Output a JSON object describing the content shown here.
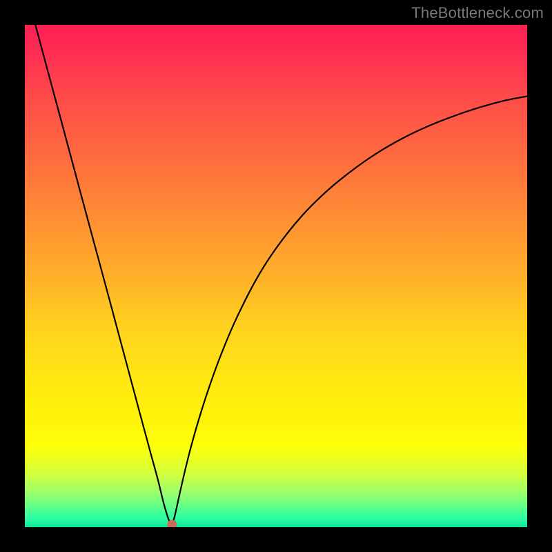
{
  "watermark": "TheBottleneck.com",
  "chart_data": {
    "type": "line",
    "title": "",
    "xlabel": "",
    "ylabel": "",
    "xlim": [
      0,
      1
    ],
    "ylim": [
      0,
      1
    ],
    "grid": false,
    "legend": false,
    "description": "Bottleneck-style curve from TheBottleneck.com: a single black line that drops steeply from the top-left, reaches a near-zero minimum around x≈0.29, then rises with decreasing slope toward the right edge (ending near y≈0.85). A small dot marks the minimum.",
    "series": [
      {
        "name": "curve",
        "color": "#000000",
        "x": [
          0.021,
          0.05,
          0.08,
          0.11,
          0.14,
          0.17,
          0.2,
          0.23,
          0.25,
          0.265,
          0.275,
          0.283,
          0.29,
          0.295,
          0.3,
          0.307,
          0.318,
          0.33,
          0.345,
          0.365,
          0.39,
          0.42,
          0.46,
          0.5,
          0.55,
          0.6,
          0.65,
          0.7,
          0.75,
          0.8,
          0.85,
          0.9,
          0.95,
          1.0
        ],
        "y": [
          1.0,
          0.892,
          0.781,
          0.669,
          0.558,
          0.447,
          0.335,
          0.223,
          0.149,
          0.094,
          0.053,
          0.025,
          0.007,
          0.011,
          0.029,
          0.061,
          0.109,
          0.157,
          0.21,
          0.273,
          0.342,
          0.413,
          0.492,
          0.555,
          0.618,
          0.668,
          0.709,
          0.744,
          0.773,
          0.797,
          0.817,
          0.834,
          0.848,
          0.858
        ]
      }
    ],
    "minimum_marker": {
      "x": 0.293,
      "y": 0.005,
      "color": "#cc6a5a",
      "radius": 7
    }
  },
  "colors": {
    "top": "#ff1e55",
    "bottom": "#10e99c",
    "line": "#000000",
    "frame": "#000000",
    "watermark": "#7a7a7a"
  }
}
